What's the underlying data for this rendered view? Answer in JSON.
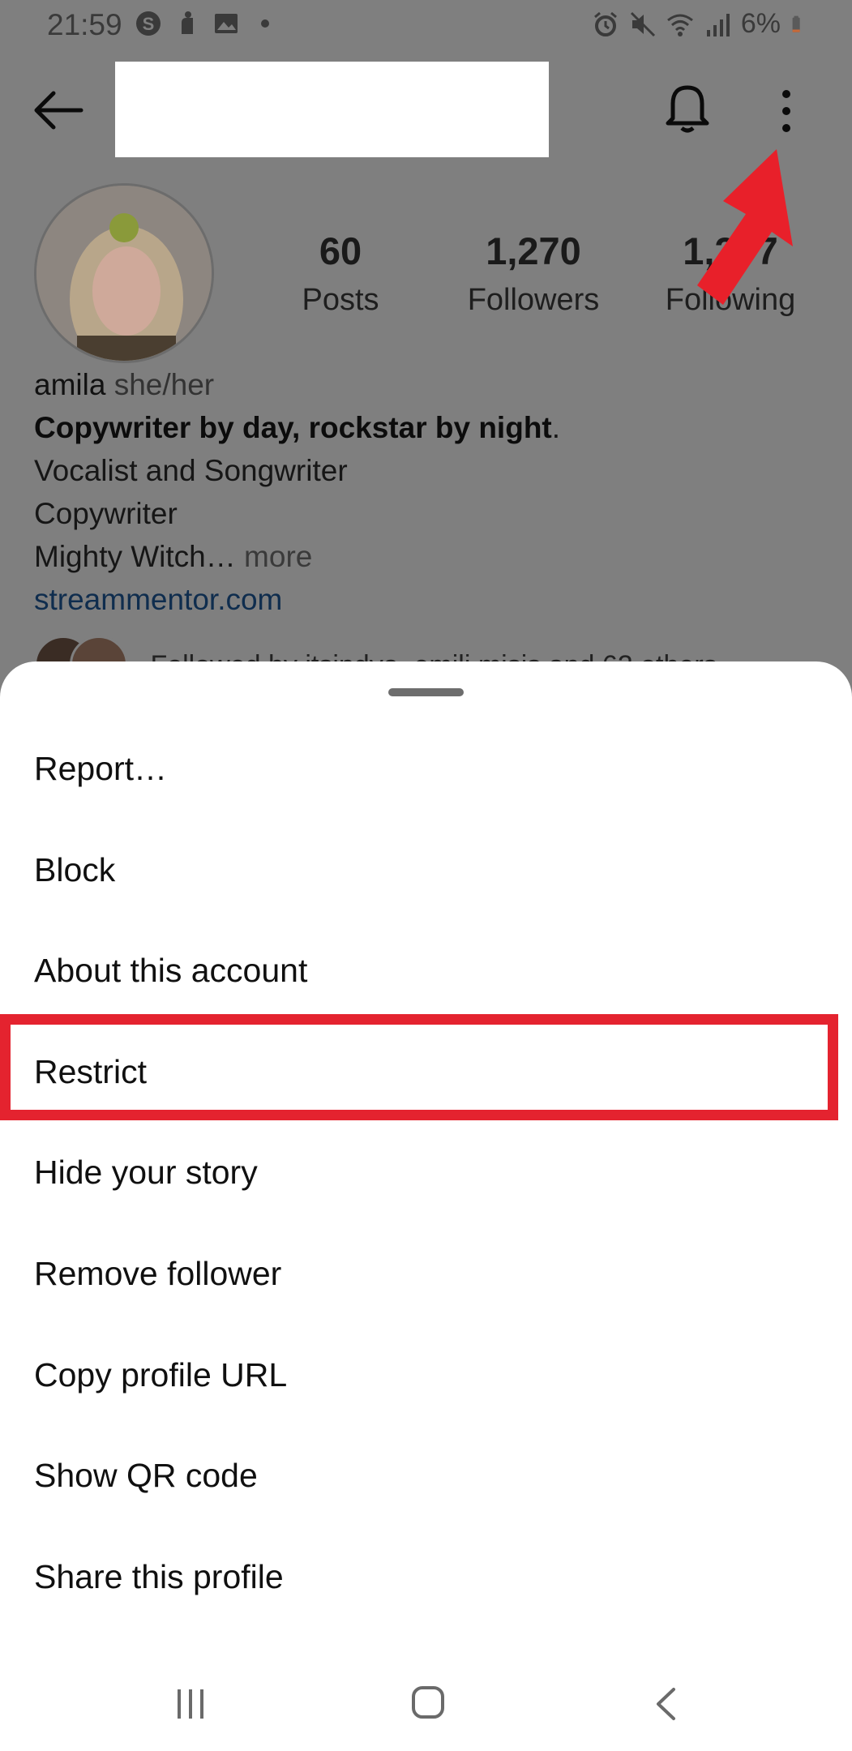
{
  "status_bar": {
    "time": "21:59",
    "battery": "6%"
  },
  "profile": {
    "username_redacted": true,
    "stats": [
      {
        "value": "60",
        "label": "Posts"
      },
      {
        "value": "1,270",
        "label": "Followers"
      },
      {
        "value": "1,277",
        "label": "Following"
      }
    ],
    "name": "amila",
    "pronouns": "she/her",
    "bio_bold": "Copywriter by day, rockstar by night",
    "bio_bold_suffix": ".",
    "bio_lines": [
      "Vocalist and Songwriter",
      "Copywriter"
    ],
    "bio_truncated": "Mighty Witch…",
    "bio_more": "more",
    "link": "streammentor.com",
    "followed_by": "Followed by itsindya, emili.misis and 62 others"
  },
  "menu": {
    "items": [
      {
        "label": "Report…"
      },
      {
        "label": "Block"
      },
      {
        "label": "About this account"
      },
      {
        "label": "Restrict",
        "highlighted": true
      },
      {
        "label": "Hide your story"
      },
      {
        "label": "Remove follower"
      },
      {
        "label": "Copy profile URL"
      },
      {
        "label": "Show QR code"
      },
      {
        "label": "Share this profile"
      }
    ]
  },
  "colors": {
    "highlight": "#e4232f",
    "arrow": "#e8202a",
    "scrim": "#7f7f7f",
    "link": "#0f2d4e"
  },
  "icons": {
    "back": "arrow-left-icon",
    "notifications": "bell-icon",
    "more": "vertical-dots-icon",
    "nav_recent": "recent-apps-icon",
    "nav_home": "home-icon",
    "nav_back": "back-chevron-icon"
  }
}
